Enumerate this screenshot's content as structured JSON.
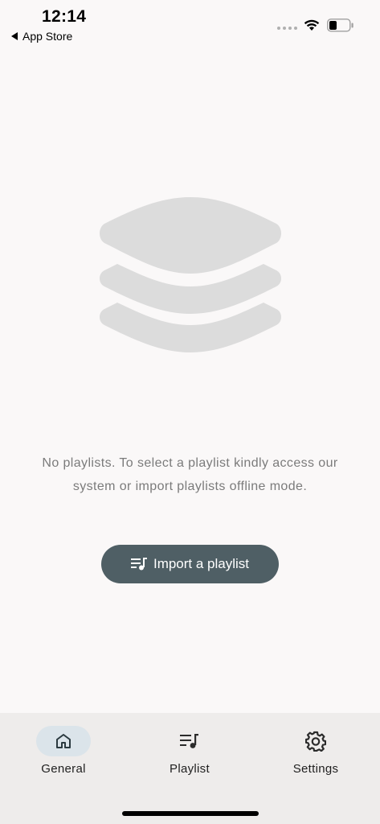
{
  "status_bar": {
    "time": "12:14",
    "back_app": "App Store"
  },
  "empty_state": {
    "icon": "layers-stack-icon",
    "message_line1": "No playlists. To select a playlist kindly access our",
    "message_line2": "system or import playlists offline mode.",
    "button_label": "Import a playlist",
    "button_icon": "playlist-music-icon"
  },
  "bottom_nav": {
    "items": [
      {
        "label": "General",
        "icon": "home-icon",
        "active": true
      },
      {
        "label": "Playlist",
        "icon": "playlist-music-icon",
        "active": false
      },
      {
        "label": "Settings",
        "icon": "gear-icon",
        "active": false
      }
    ]
  },
  "colors": {
    "background": "#faf8f8",
    "button": "#4f5f65",
    "nav_background": "#eeeceb",
    "active_pill": "#dbe4ea",
    "message_text": "#7b7b7b",
    "stack_icon": "#dcdcdc"
  }
}
